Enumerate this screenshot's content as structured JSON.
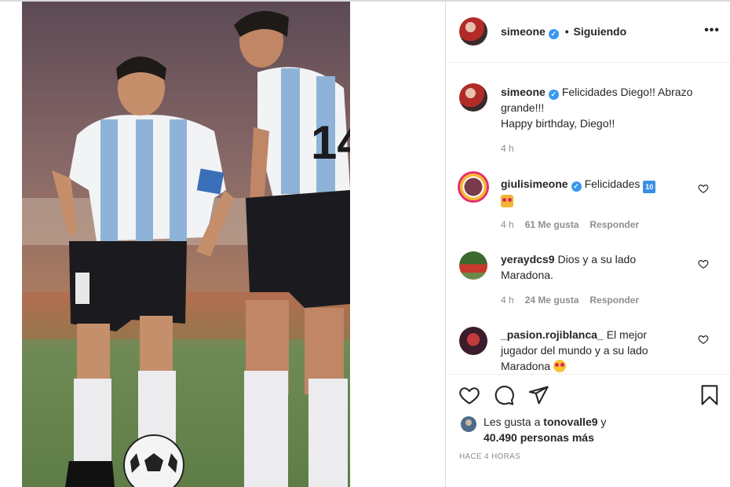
{
  "post": {
    "user": "simeone",
    "follow_dot": "•",
    "follow_status": "Siguiendo",
    "more_icon": "more-horizontal-icon"
  },
  "caption": {
    "user": "simeone",
    "text_line1": "Felicidades Diego!! Abrazo",
    "text_line2": "grande!!!",
    "text_line3": "Happy birthday, Diego!!",
    "time": "4 h"
  },
  "comments": [
    {
      "user": "giulisimeone",
      "text": "Felicidades",
      "emoji1": "10",
      "time": "4 h",
      "likes": "61 Me gusta",
      "reply": "Responder"
    },
    {
      "user": "yeraydcs9",
      "text_line1": "Dios y a su lado",
      "text_line2": "Maradona.",
      "time": "4 h",
      "likes": "24 Me gusta",
      "reply": "Responder"
    },
    {
      "user": "_pasion.rojiblanca_",
      "text_line1": "El mejor",
      "text_line2": "jugador del mundo y a su lado",
      "text_line3": "Maradona"
    }
  ],
  "likes": {
    "prefix": "Les gusta a",
    "user": "tonovalle9",
    "suffix": "y",
    "count": "40.490 personas más"
  },
  "posted_ago": "HACE 4 HORAS",
  "colors": {
    "verified": "#3897f0",
    "meta_text": "#8e8e8e",
    "text": "#262626"
  }
}
